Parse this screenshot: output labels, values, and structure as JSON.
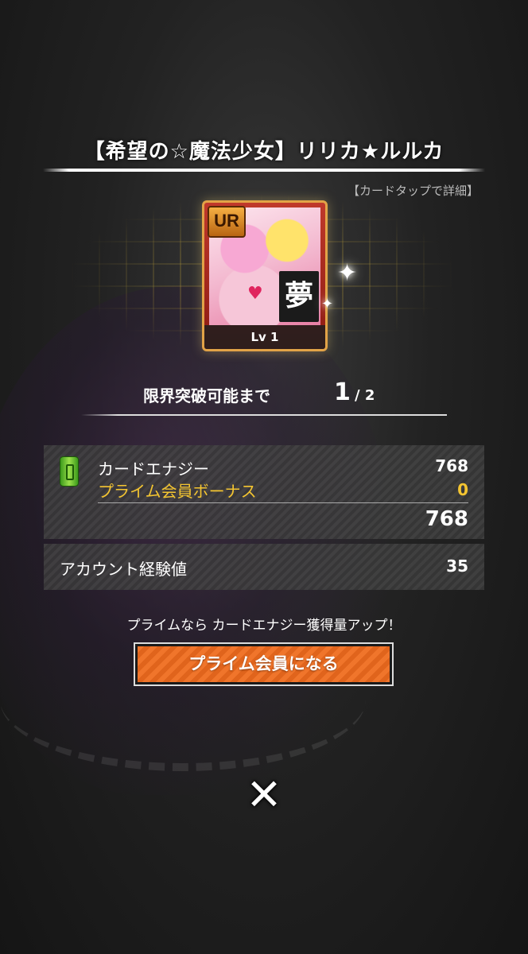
{
  "card": {
    "title": "【希望の☆魔法少女】リリカ★ルルカ",
    "detail_hint": "【カードタップで詳細】",
    "rarity": "UR",
    "attribute": "夢",
    "level": "Lv 1"
  },
  "limit_break": {
    "label": "限界突破可能まで",
    "current": "1",
    "max": "/ 2"
  },
  "energy": {
    "icon": "energy-can-icon",
    "label": "カードエナジー",
    "value": "768",
    "bonus_label": "プライム会員ボーナス",
    "bonus_value": "0",
    "total": "768"
  },
  "account": {
    "exp_label": "アカウント経験値",
    "exp_value": "35"
  },
  "prime": {
    "note": "プライムなら カードエナジー獲得量アップ！",
    "button_label": "プライム会員になる"
  },
  "close": {
    "icon": "close-icon",
    "glyph": "✕"
  },
  "colors": {
    "gold_text": "#f4c531",
    "prime_button": "#f0752b",
    "card_frame": "#e2a347"
  }
}
